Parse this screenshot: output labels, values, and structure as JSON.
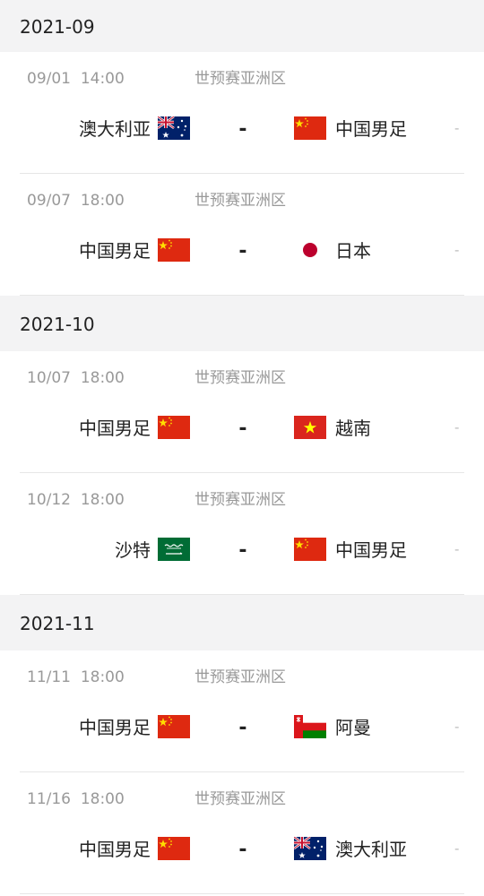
{
  "months": [
    {
      "label": "2021-09",
      "matches": [
        {
          "date": "09/01",
          "time": "14:00",
          "competition": "世预赛亚洲区",
          "home": "澳大利亚",
          "home_flag": "australia-flag",
          "separator": "-",
          "away": "中国男足",
          "away_flag": "china-flag",
          "score": "-"
        },
        {
          "date": "09/07",
          "time": "18:00",
          "competition": "世预赛亚洲区",
          "home": "中国男足",
          "home_flag": "china-flag",
          "separator": "-",
          "away": "日本",
          "away_flag": "japan-flag",
          "score": "-"
        }
      ]
    },
    {
      "label": "2021-10",
      "matches": [
        {
          "date": "10/07",
          "time": "18:00",
          "competition": "世预赛亚洲区",
          "home": "中国男足",
          "home_flag": "china-flag",
          "separator": "-",
          "away": "越南",
          "away_flag": "vietnam-flag",
          "score": "-"
        },
        {
          "date": "10/12",
          "time": "18:00",
          "competition": "世预赛亚洲区",
          "home": "沙特",
          "home_flag": "saudi-flag",
          "separator": "-",
          "away": "中国男足",
          "away_flag": "china-flag",
          "score": "-"
        }
      ]
    },
    {
      "label": "2021-11",
      "matches": [
        {
          "date": "11/11",
          "time": "18:00",
          "competition": "世预赛亚洲区",
          "home": "中国男足",
          "home_flag": "china-flag",
          "separator": "-",
          "away": "阿曼",
          "away_flag": "oman-flag",
          "score": "-"
        },
        {
          "date": "11/16",
          "time": "18:00",
          "competition": "世预赛亚洲区",
          "home": "中国男足",
          "home_flag": "china-flag",
          "separator": "-",
          "away": "澳大利亚",
          "away_flag": "australia-flag",
          "score": "-"
        }
      ]
    }
  ],
  "colors": {
    "header_bg": "#f3f3f4",
    "china_red": "#de2910",
    "china_yellow": "#ffde00",
    "japan_red": "#bc002d",
    "saudi_green": "#006c35",
    "australia_blue": "#012169",
    "oman_red": "#db161b",
    "oman_green": "#008000"
  }
}
